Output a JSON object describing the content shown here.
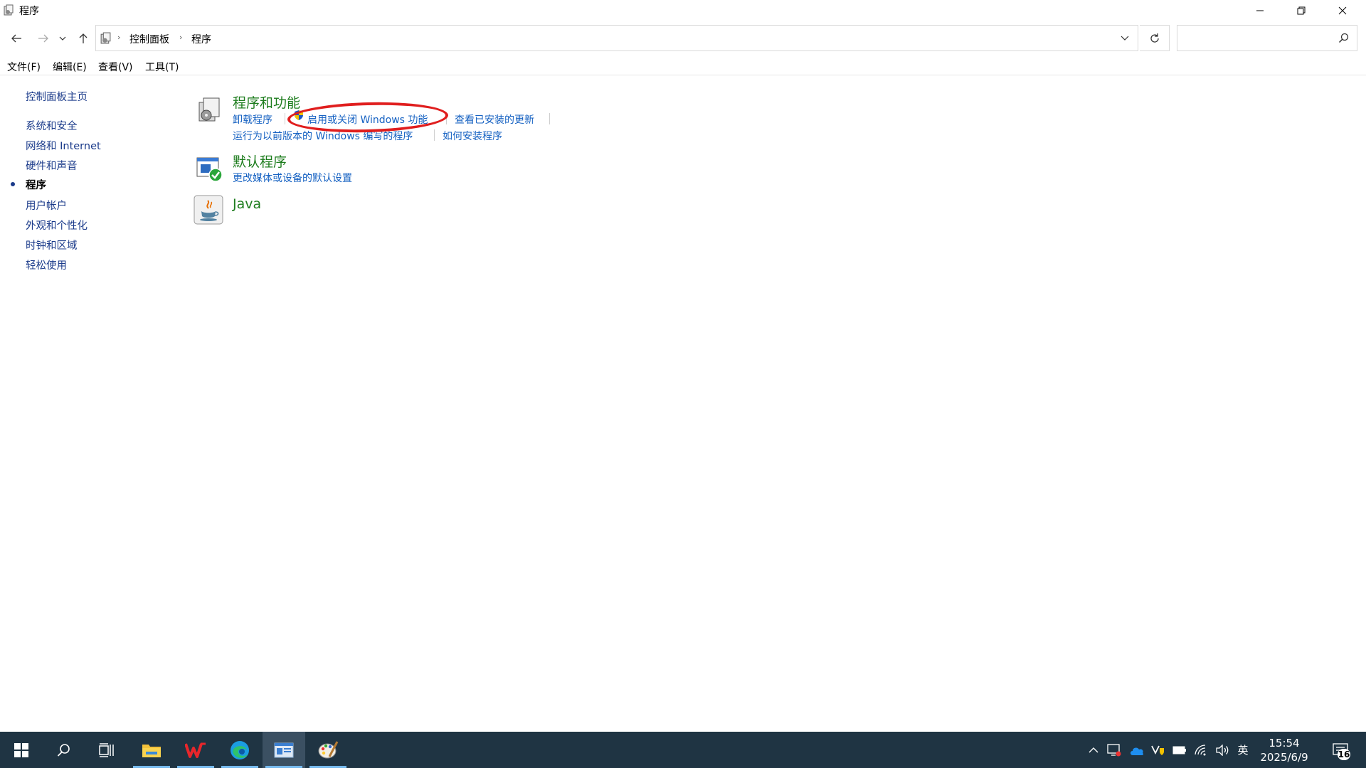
{
  "window": {
    "title": "程序"
  },
  "address": {
    "crumbs": [
      "控制面板",
      "程序"
    ],
    "search_placeholder": ""
  },
  "menu": [
    "文件(F)",
    "编辑(E)",
    "查看(V)",
    "工具(T)"
  ],
  "sidebar": {
    "home": "控制面板主页",
    "items": [
      "系统和安全",
      "网络和 Internet",
      "硬件和声音",
      "程序",
      "用户帐户",
      "外观和个性化",
      "时钟和区域",
      "轻松使用"
    ],
    "current": "程序"
  },
  "categories": [
    {
      "title": "程序和功能",
      "icon": "programs-features-icon",
      "links": [
        "卸载程序",
        "启用或关闭 Windows 功能",
        "查看已安装的更新",
        "运行为以前版本的 Windows 编写的程序",
        "如何安装程序"
      ]
    },
    {
      "title": "默认程序",
      "icon": "default-programs-icon",
      "links": [
        "更改媒体或设备的默认设置"
      ]
    },
    {
      "title": "Java",
      "icon": "java-icon",
      "links": []
    }
  ],
  "annotation": {
    "color": "#e01e1e",
    "target": "启用或关闭 Windows 功能"
  },
  "taskbar": {
    "apps": [
      "start-icon",
      "search-icon",
      "task-view-icon",
      "file-explorer-icon",
      "wps-icon",
      "edge-icon",
      "control-panel-icon",
      "paint-icon"
    ],
    "ime": "英",
    "time": "15:54",
    "date": "2025/6/9",
    "notification_count": "16"
  },
  "colors": {
    "link": "#1561c2",
    "category_title": "#1e7d1e",
    "sidebar_link": "#1a3a8a",
    "taskbar": "#1f3443"
  }
}
